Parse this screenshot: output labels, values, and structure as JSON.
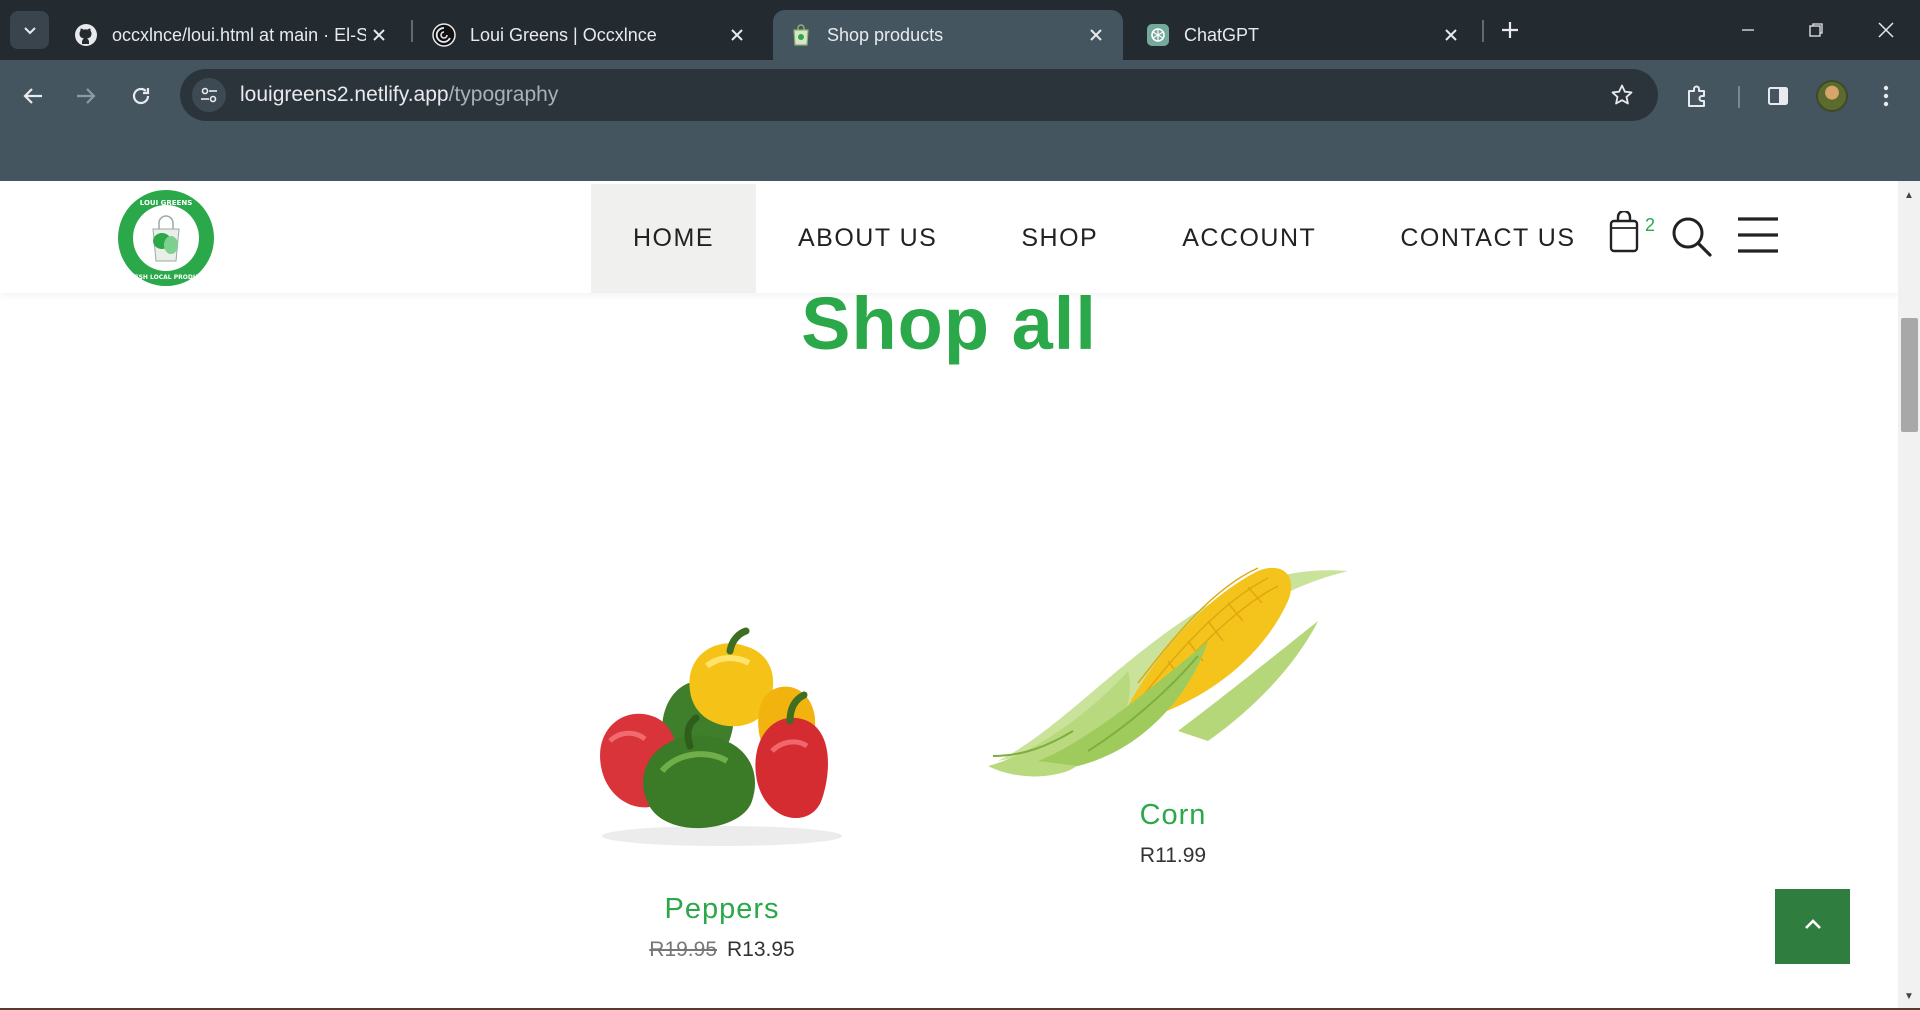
{
  "browser": {
    "tabs": [
      {
        "title": "occxlnce/loui.html at main · El-S",
        "icon": "github-icon"
      },
      {
        "title": "Loui Greens | Occxlnce",
        "icon": "spiral-icon"
      },
      {
        "title": "Shop products",
        "icon": "bag-icon"
      },
      {
        "title": "ChatGPT",
        "icon": "chatgpt-icon"
      }
    ],
    "url_host": "louigreens2.netlify.app",
    "url_path": "/typography"
  },
  "site": {
    "logo_alt": "Loui Greens - Fresh Local Produce",
    "logo_text_top": "LOUI GREENS",
    "logo_text_bottom": "FRESH LOCAL PRODUCE",
    "nav": [
      "HOME",
      "ABOUT US",
      "SHOP",
      "ACCOUNT",
      "CONTACT US"
    ],
    "active_nav": "HOME",
    "cart_count": "2",
    "brand_color": "#2aa84a",
    "button_color": "#2f7d3f"
  },
  "main": {
    "heading": "Shop all",
    "products": [
      {
        "name": "Peppers",
        "old_price": "R19.95",
        "price": "R13.95"
      },
      {
        "name": "Corn",
        "price": "R11.99"
      }
    ]
  }
}
